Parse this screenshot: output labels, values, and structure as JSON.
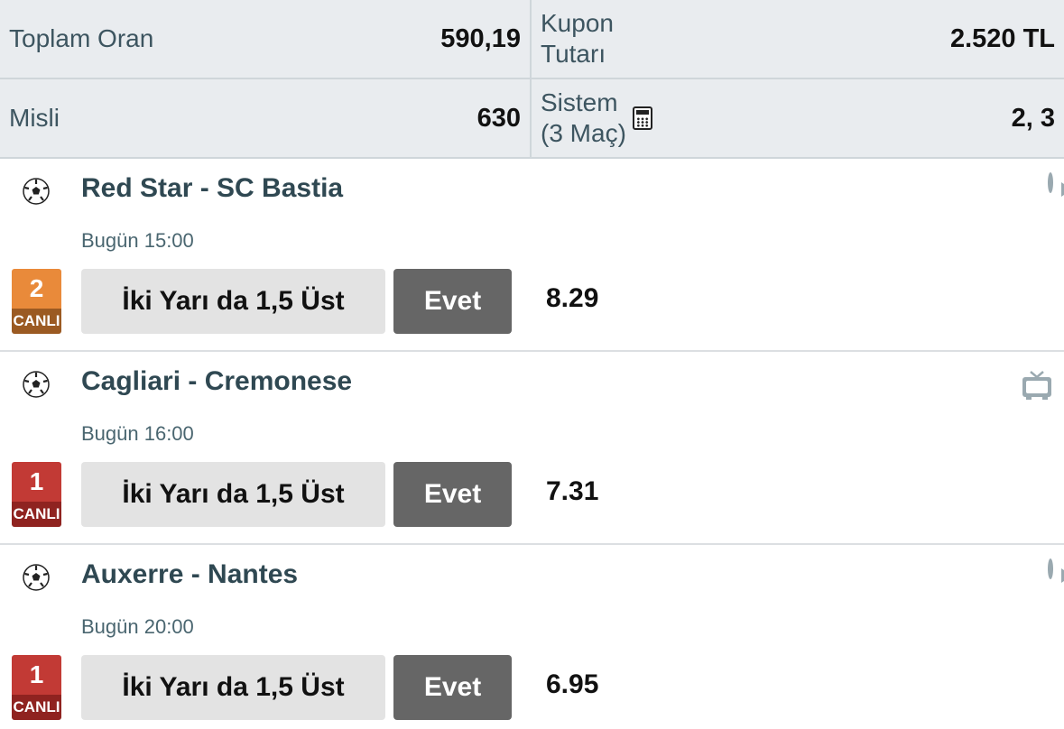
{
  "summary": {
    "total_odds_label": "Toplam Oran",
    "total_odds_value": "590,19",
    "coupon_label_line1": "Kupon",
    "coupon_label_line2": "Tutarı",
    "coupon_value": "2.520 TL",
    "multiplier_label": "Misli",
    "multiplier_value": "630",
    "system_label_line1": "Sistem",
    "system_label_line2": "(3 Maç)",
    "system_value": "2, 3"
  },
  "matches": [
    {
      "name": "Red Star - SC Bastia",
      "time": "Bugün 15:00",
      "mbs": "2",
      "live_label": "CANLI",
      "market": "İki Yarı da 1,5 Üst",
      "pick": "Evet",
      "odd": "8.29",
      "right_icon": "play-icon",
      "badge_color": "#e98a3a"
    },
    {
      "name": "Cagliari - Cremonese",
      "time": "Bugün 16:00",
      "mbs": "1",
      "live_label": "CANLI",
      "market": "İki Yarı da 1,5 Üst",
      "pick": "Evet",
      "odd": "7.31",
      "right_icon": "tv-icon",
      "badge_color": "#c23a35"
    },
    {
      "name": "Auxerre - Nantes",
      "time": "Bugün 20:00",
      "mbs": "1",
      "live_label": "CANLI",
      "market": "İki Yarı da 1,5 Üst",
      "pick": "Evet",
      "odd": "6.95",
      "right_icon": "play-icon",
      "badge_color": "#c23a35"
    }
  ]
}
